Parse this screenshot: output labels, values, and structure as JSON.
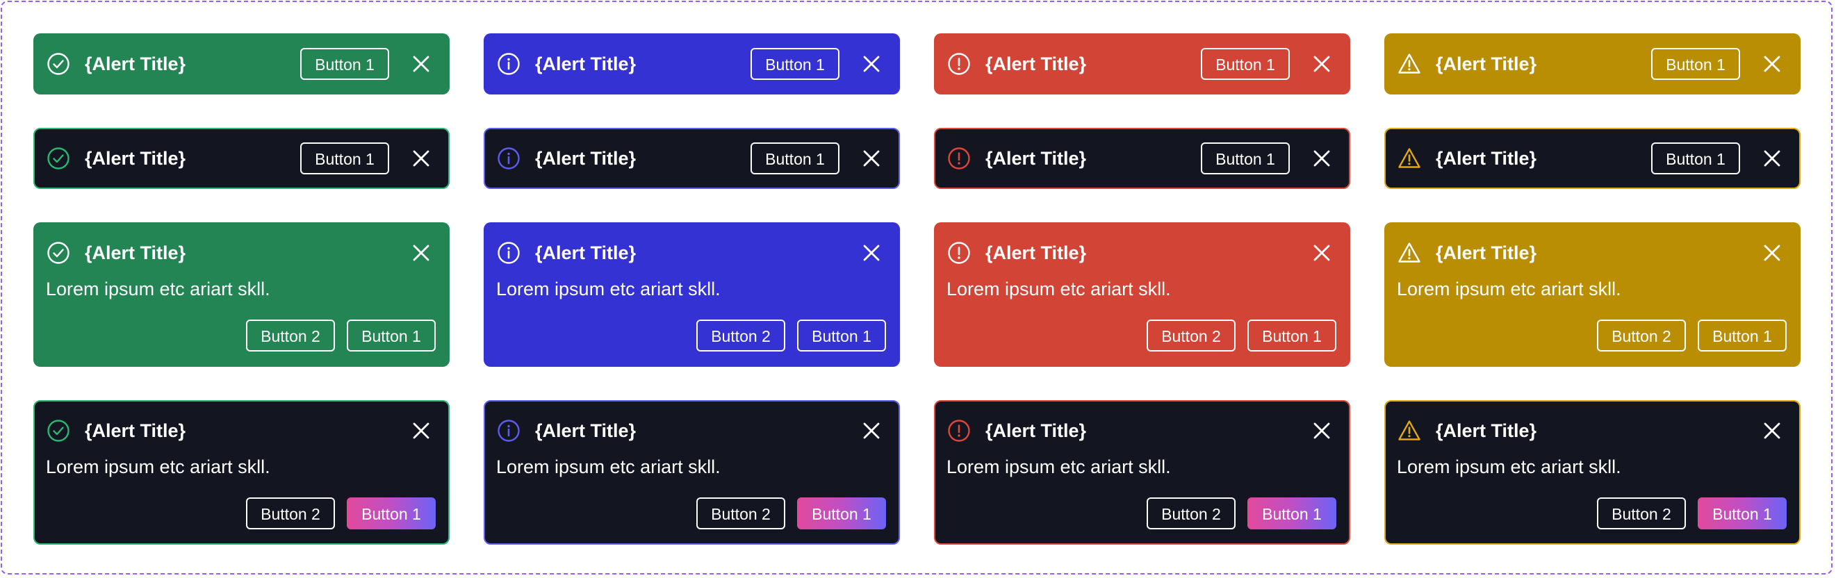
{
  "alerts": {
    "title": "{Alert Title}",
    "description": "Lorem ipsum etc ariart skll.",
    "button_1_label": "Button 1",
    "button_2_label": "Button 2"
  },
  "variants": [
    {
      "name": "success",
      "icon": "check-circle-icon",
      "fill_color": "#238554",
      "accent_color": "#28b873"
    },
    {
      "name": "info",
      "icon": "info-circle-icon",
      "fill_color": "#3432d2",
      "accent_color": "#5b5cf0"
    },
    {
      "name": "error",
      "icon": "exclamation-circle-icon",
      "fill_color": "#d24436",
      "accent_color": "#e0453a"
    },
    {
      "name": "warning",
      "icon": "warning-triangle-icon",
      "fill_color": "#b98e03",
      "accent_color": "#e0a90f"
    }
  ],
  "colors": {
    "dark_background": "#131620",
    "frame_border": "#9b5cf0",
    "gradient_button": [
      "#e24a9c",
      "#6b63f5"
    ]
  }
}
